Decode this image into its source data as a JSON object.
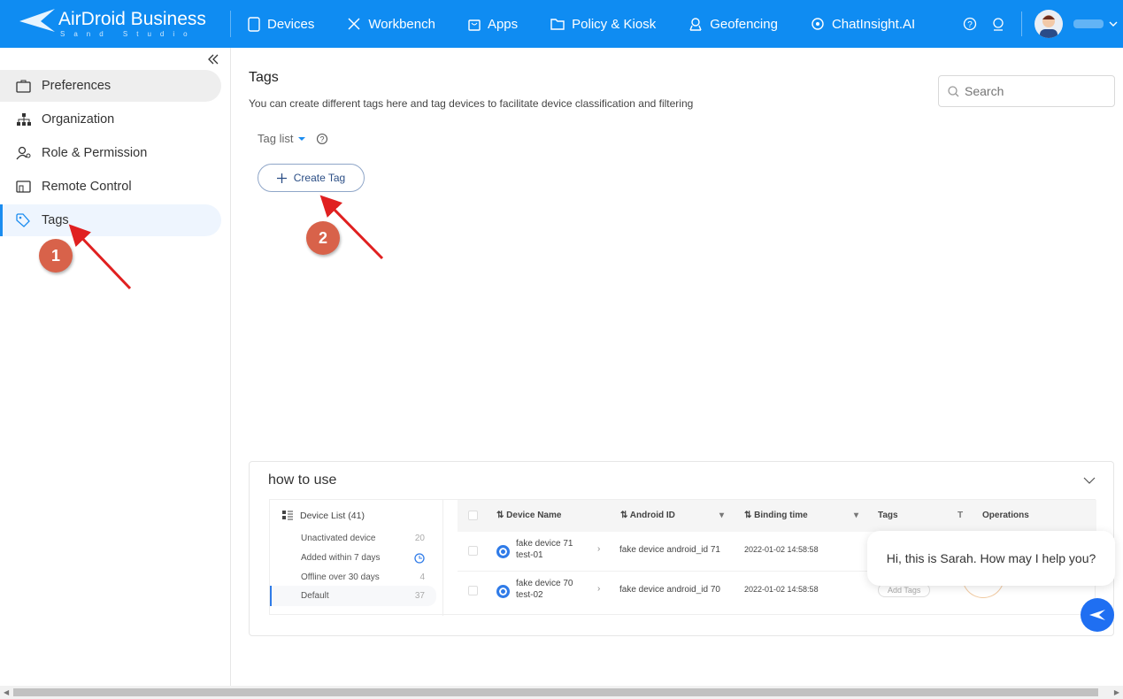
{
  "header": {
    "brand": "AirDroid Business",
    "brand_sub": "Sand Studio",
    "nav": [
      {
        "label": "Devices",
        "icon": "tablet-icon"
      },
      {
        "label": "Workbench",
        "icon": "tools-icon"
      },
      {
        "label": "Apps",
        "icon": "bag-icon"
      },
      {
        "label": "Policy & Kiosk",
        "icon": "folder-icon"
      },
      {
        "label": "Geofencing",
        "icon": "map-pin-icon"
      },
      {
        "label": "ChatInsight.AI",
        "icon": "chat-ai-icon"
      }
    ],
    "accent": "#0f8cf2"
  },
  "sidebar": {
    "items": [
      {
        "label": "Preferences"
      },
      {
        "label": "Organization"
      },
      {
        "label": "Role & Permission"
      },
      {
        "label": "Remote Control"
      },
      {
        "label": "Tags",
        "active": true
      }
    ]
  },
  "main": {
    "title": "Tags",
    "description": "You can create different tags here and tag devices to facilitate device classification and filtering",
    "search_placeholder": "Search",
    "tag_list_label": "Tag list",
    "create_tag_label": "Create Tag"
  },
  "how_to_use": {
    "title": "how to use",
    "device_list": {
      "title": "Device List (41)",
      "groups": [
        {
          "label": "Unactivated device",
          "count": "20"
        },
        {
          "label": "Added within 7 days",
          "count": ""
        },
        {
          "label": "Offline over 30 days",
          "count": "4"
        },
        {
          "label": "Default",
          "count": "37"
        }
      ]
    },
    "table": {
      "headers": [
        "Device Name",
        "Android ID",
        "Binding time",
        "Tags",
        "Operations"
      ],
      "rows": [
        {
          "name": "fake device 71",
          "sub": "test-01",
          "android_id": "fake device android_id 71",
          "binding": "2022-01-02 14:58:58"
        },
        {
          "name": "fake device 70",
          "sub": "test-02",
          "android_id": "fake device android_id 70",
          "binding": "2022-01-02 14:58:58",
          "tags": "Add Tags"
        }
      ]
    }
  },
  "chat": {
    "message": "Hi, this is Sarah. How may I help you?"
  },
  "annotations": [
    "1",
    "2"
  ]
}
